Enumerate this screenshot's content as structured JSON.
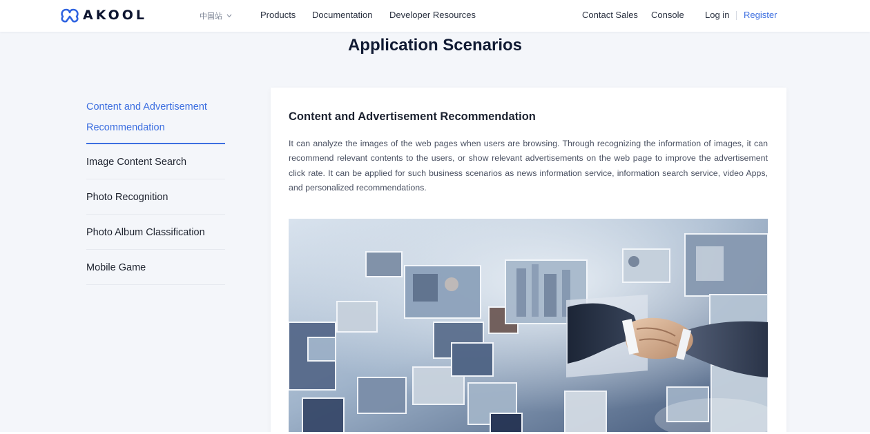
{
  "header": {
    "brand": "AKOOL",
    "region_label": "中国站",
    "nav": {
      "products": "Products",
      "documentation": "Documentation",
      "developer_resources": "Developer Resources",
      "contact_sales": "Contact Sales",
      "console": "Console",
      "login": "Log in",
      "register": "Register"
    }
  },
  "section_title": "Application Scenarios",
  "side_menu": {
    "items": [
      {
        "label": "Content and Advertisement Recommendation",
        "active": true
      },
      {
        "label": "Image Content Search",
        "active": false
      },
      {
        "label": "Photo Recognition",
        "active": false
      },
      {
        "label": "Photo Album Classification",
        "active": false
      },
      {
        "label": "Mobile Game",
        "active": false
      }
    ]
  },
  "content": {
    "heading": "Content and Advertisement Recommendation",
    "description": "It can analyze the images of the web pages when users are browsing. Through recognizing the information of images, it can recommend relevant contents to the users, or show relevant advertisements on the web page to improve the advertisement click rate. It can be applied for such business scenarios as news information service, information search service, video Apps, and personalized recommendations.",
    "image_subject": "business-collage-handshake"
  },
  "colors": {
    "accent": "#3d6fe0",
    "page_bg": "#f4f6fa",
    "text_dark": "#101a33"
  }
}
